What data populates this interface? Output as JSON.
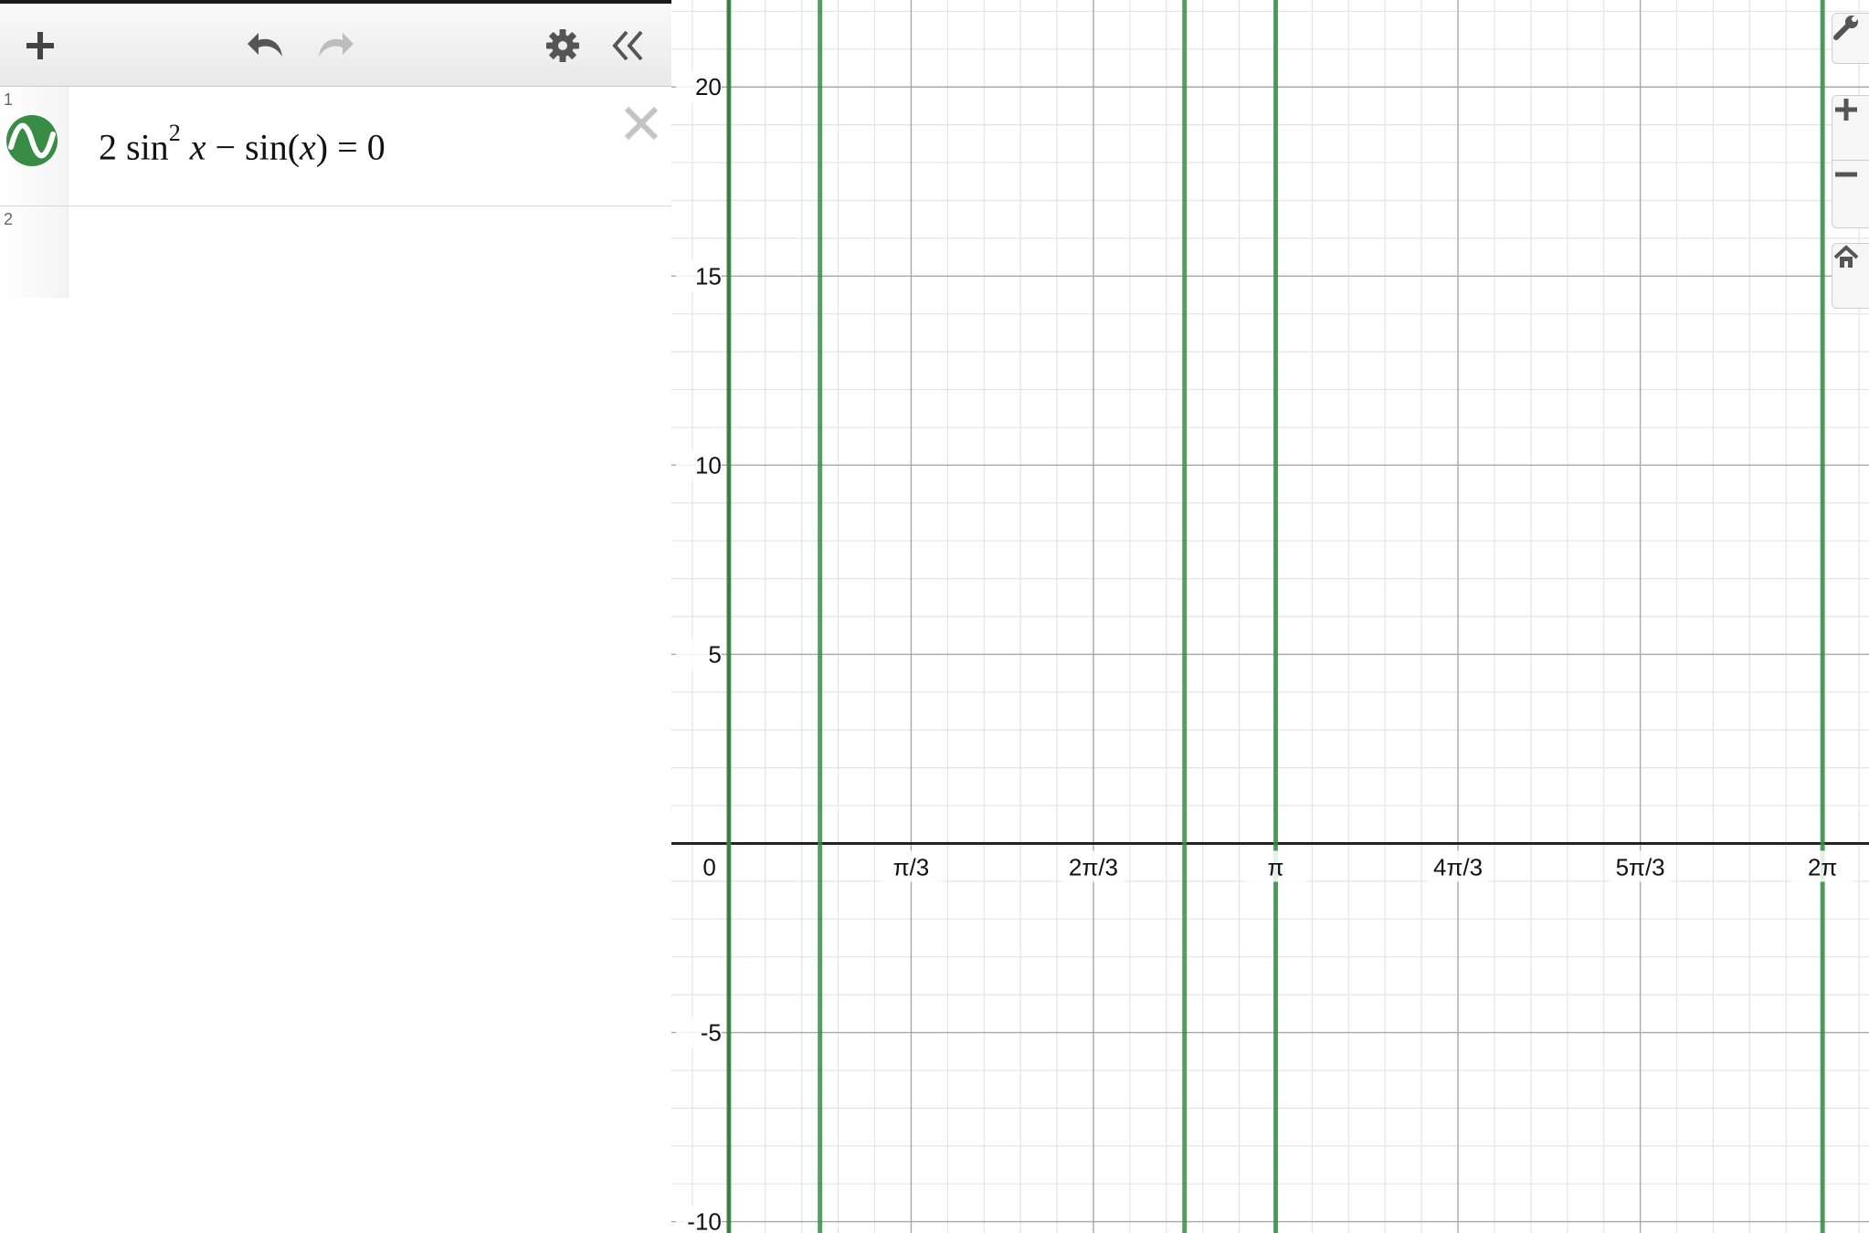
{
  "toolbar": {
    "add_icon": "plus-icon",
    "undo_icon": "undo-icon",
    "redo_icon": "redo-icon",
    "settings_icon": "gear-icon",
    "collapse_icon": "double-chevron-left-icon"
  },
  "expressions": [
    {
      "index": "1",
      "coef": "2",
      "fn1": "sin",
      "exp": "2",
      "var1": "x",
      "minus": "−",
      "fn2": "sin",
      "lparen": "(",
      "var2": "x",
      "rparen": ")",
      "equals": "=",
      "rhs": "0",
      "color": "#388c46"
    },
    {
      "index": "2"
    }
  ],
  "graph_controls": {
    "settings_icon": "wrench-icon",
    "zoom_in_icon": "plus-icon",
    "zoom_out_icon": "minus-icon",
    "home_icon": "home-icon"
  },
  "chart_data": {
    "type": "line",
    "description_equation": "2 sin^2 x − sin(x) = 0",
    "series_color": "#388c46",
    "solutions_x": [
      0,
      0.5236,
      2.618,
      3.1416,
      6.2832
    ],
    "xlim": [
      -0.33,
      6.55
    ],
    "ylim": [
      -10.3,
      22.3
    ],
    "x_ticks": [
      {
        "value": 1.0472,
        "label": "π/3"
      },
      {
        "value": 2.0944,
        "label": "2π/3"
      },
      {
        "value": 3.1416,
        "label": "π"
      },
      {
        "value": 4.1888,
        "label": "4π/3"
      },
      {
        "value": 5.236,
        "label": "5π/3"
      },
      {
        "value": 6.2832,
        "label": "2π"
      }
    ],
    "origin_label": "0",
    "y_ticks": [
      {
        "value": 20,
        "label": "20"
      },
      {
        "value": 15,
        "label": "15"
      },
      {
        "value": 10,
        "label": "10"
      },
      {
        "value": 5,
        "label": "5"
      },
      {
        "value": -5,
        "label": "-5"
      },
      {
        "value": -10,
        "label": "-10"
      }
    ],
    "grid": true
  }
}
